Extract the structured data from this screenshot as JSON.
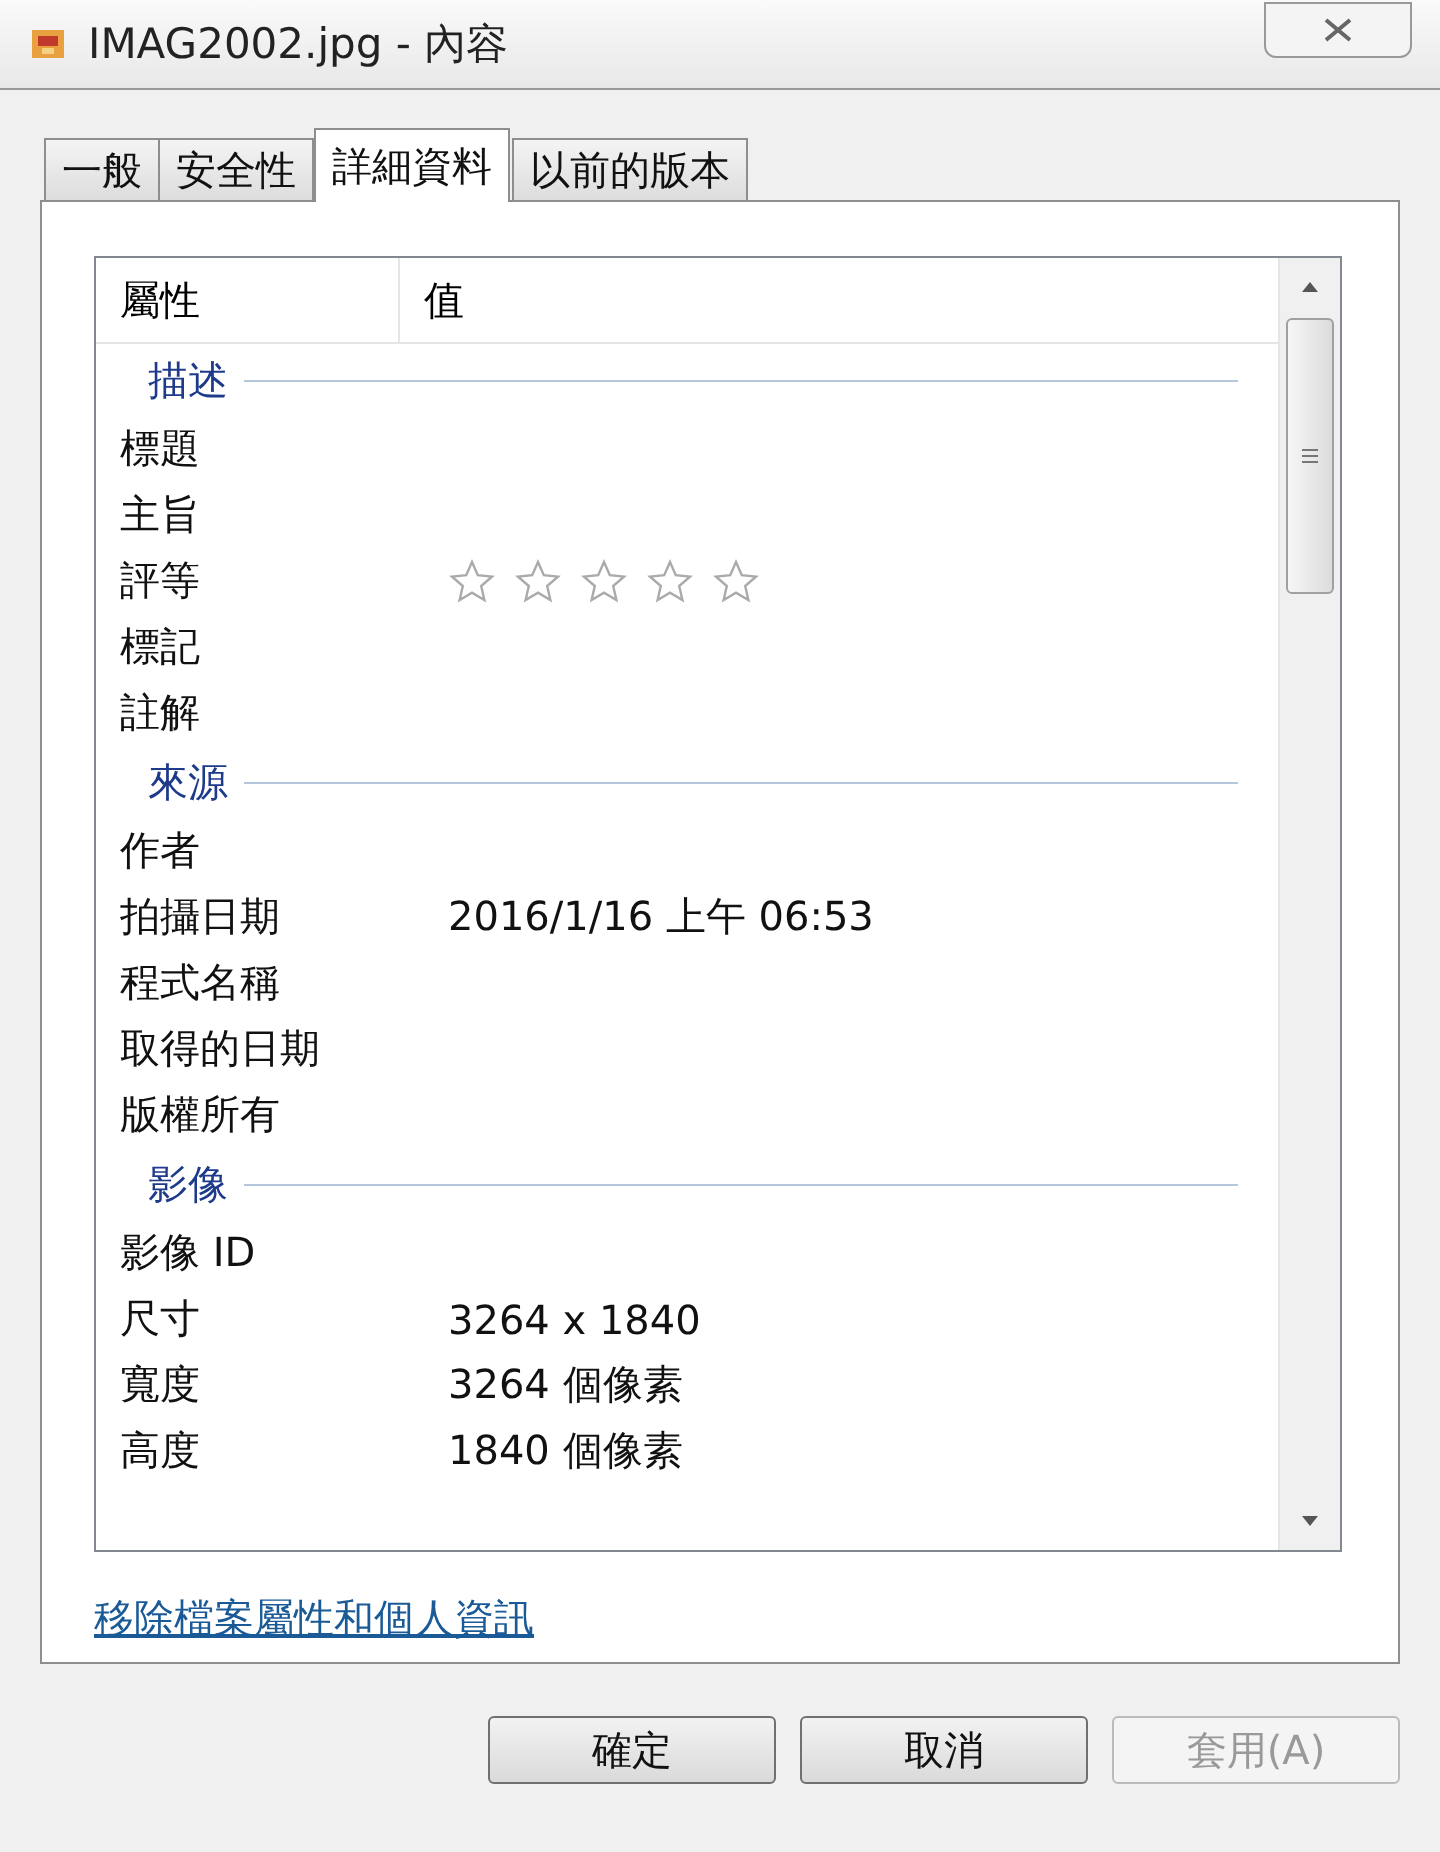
{
  "window": {
    "title": "IMAG2002.jpg - 內容"
  },
  "tabs": [
    {
      "label": "一般",
      "selected": false
    },
    {
      "label": "安全性",
      "selected": false
    },
    {
      "label": "詳細資料",
      "selected": true
    },
    {
      "label": "以前的版本",
      "selected": false
    }
  ],
  "table": {
    "columns": [
      "屬性",
      "值"
    ],
    "sections": [
      {
        "name": "描述",
        "rows": [
          {
            "kind": "text",
            "name": "標題"
          },
          {
            "kind": "text",
            "name": "主旨"
          },
          {
            "kind": "rating",
            "name": "評等",
            "stars": 0
          },
          {
            "kind": "text",
            "name": "標記"
          },
          {
            "kind": "text",
            "name": "註解"
          }
        ]
      },
      {
        "name": "來源",
        "rows": [
          {
            "kind": "text",
            "name": "作者"
          },
          {
            "kind": "text",
            "name": "拍攝日期",
            "value": "2016/1/16 上午 06:53"
          },
          {
            "kind": "text",
            "name": "程式名稱"
          },
          {
            "kind": "text",
            "name": "取得的日期"
          },
          {
            "kind": "text",
            "name": "版權所有"
          }
        ]
      },
      {
        "name": "影像",
        "rows": [
          {
            "kind": "text",
            "name": "影像 ID"
          },
          {
            "kind": "text",
            "name": "尺寸",
            "value": "3264 x 1840"
          },
          {
            "kind": "text",
            "name": "寬度",
            "value": "3264 個像素"
          },
          {
            "kind": "text",
            "name": "高度",
            "value": "1840 個像素"
          }
        ]
      }
    ]
  },
  "link": "移除檔案屬性和個人資訊",
  "buttons": [
    {
      "label": "確定",
      "disabled": false
    },
    {
      "label": "取消",
      "disabled": false
    },
    {
      "label": "套用(A)",
      "disabled": true
    }
  ]
}
